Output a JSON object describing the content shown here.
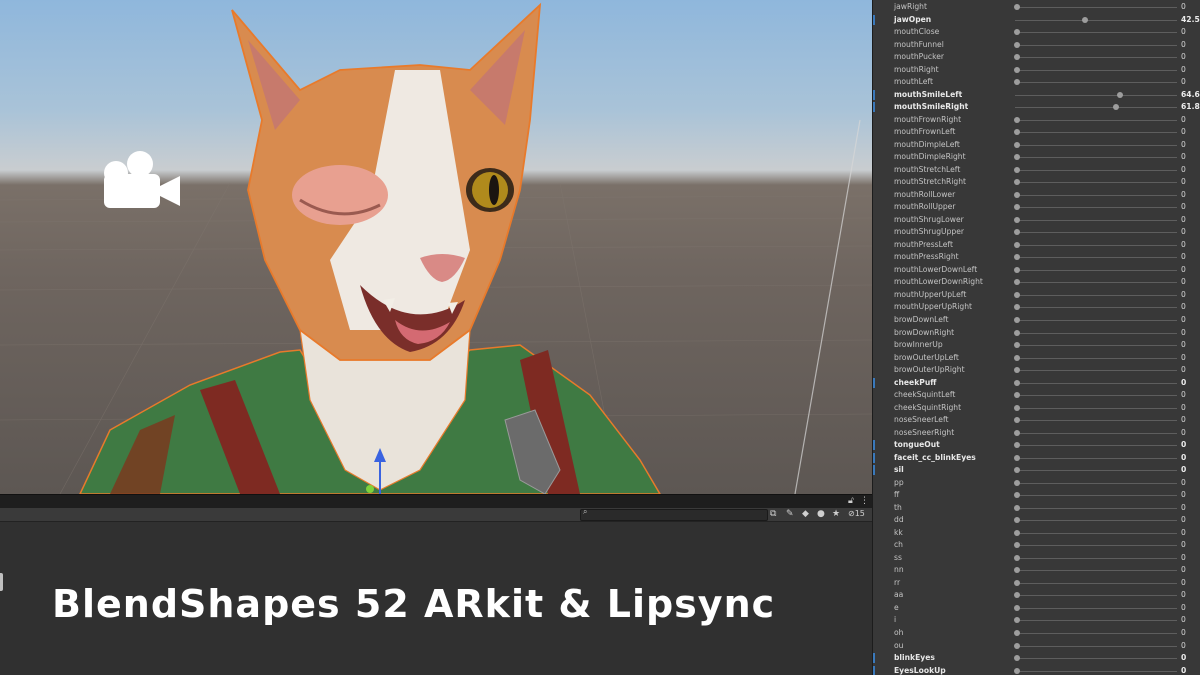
{
  "title": "BlendShapes 52 ARkit & Lipsync",
  "console": {
    "badge_count": "15"
  },
  "colors": {
    "accent": "#3a79bb",
    "selection_outline": "#e87a2b",
    "panel": "#383838"
  },
  "icons": [
    "camera-gizmo-icon",
    "search-icon",
    "lock-icon",
    "menu-icon",
    "filter-icon",
    "tag-icon",
    "error-icon",
    "star-icon",
    "visibility-icon"
  ],
  "blendshapes": [
    {
      "name": "jawRight",
      "value": "0",
      "fraction": 0,
      "bold": false
    },
    {
      "name": "jawOpen",
      "value": "42.5",
      "fraction": 0.425,
      "bold": true
    },
    {
      "name": "mouthClose",
      "value": "0",
      "fraction": 0,
      "bold": false
    },
    {
      "name": "mouthFunnel",
      "value": "0",
      "fraction": 0,
      "bold": false
    },
    {
      "name": "mouthPucker",
      "value": "0",
      "fraction": 0,
      "bold": false
    },
    {
      "name": "mouthRight",
      "value": "0",
      "fraction": 0,
      "bold": false
    },
    {
      "name": "mouthLeft",
      "value": "0",
      "fraction": 0,
      "bold": false
    },
    {
      "name": "mouthSmileLeft",
      "value": "64.6",
      "fraction": 0.646,
      "bold": true
    },
    {
      "name": "mouthSmileRight",
      "value": "61.8",
      "fraction": 0.618,
      "bold": true
    },
    {
      "name": "mouthFrownRight",
      "value": "0",
      "fraction": 0,
      "bold": false
    },
    {
      "name": "mouthFrownLeft",
      "value": "0",
      "fraction": 0,
      "bold": false
    },
    {
      "name": "mouthDimpleLeft",
      "value": "0",
      "fraction": 0,
      "bold": false
    },
    {
      "name": "mouthDimpleRight",
      "value": "0",
      "fraction": 0,
      "bold": false
    },
    {
      "name": "mouthStretchLeft",
      "value": "0",
      "fraction": 0,
      "bold": false
    },
    {
      "name": "mouthStretchRight",
      "value": "0",
      "fraction": 0,
      "bold": false
    },
    {
      "name": "mouthRollLower",
      "value": "0",
      "fraction": 0,
      "bold": false
    },
    {
      "name": "mouthRollUpper",
      "value": "0",
      "fraction": 0,
      "bold": false
    },
    {
      "name": "mouthShrugLower",
      "value": "0",
      "fraction": 0,
      "bold": false
    },
    {
      "name": "mouthShrugUpper",
      "value": "0",
      "fraction": 0,
      "bold": false
    },
    {
      "name": "mouthPressLeft",
      "value": "0",
      "fraction": 0,
      "bold": false
    },
    {
      "name": "mouthPressRight",
      "value": "0",
      "fraction": 0,
      "bold": false
    },
    {
      "name": "mouthLowerDownLeft",
      "value": "0",
      "fraction": 0,
      "bold": false
    },
    {
      "name": "mouthLowerDownRight",
      "value": "0",
      "fraction": 0,
      "bold": false
    },
    {
      "name": "mouthUpperUpLeft",
      "value": "0",
      "fraction": 0,
      "bold": false
    },
    {
      "name": "mouthUpperUpRight",
      "value": "0",
      "fraction": 0,
      "bold": false
    },
    {
      "name": "browDownLeft",
      "value": "0",
      "fraction": 0,
      "bold": false
    },
    {
      "name": "browDownRight",
      "value": "0",
      "fraction": 0,
      "bold": false
    },
    {
      "name": "browInnerUp",
      "value": "0",
      "fraction": 0,
      "bold": false
    },
    {
      "name": "browOuterUpLeft",
      "value": "0",
      "fraction": 0,
      "bold": false
    },
    {
      "name": "browOuterUpRight",
      "value": "0",
      "fraction": 0,
      "bold": false
    },
    {
      "name": "cheekPuff",
      "value": "0",
      "fraction": 0,
      "bold": true
    },
    {
      "name": "cheekSquintLeft",
      "value": "0",
      "fraction": 0,
      "bold": false
    },
    {
      "name": "cheekSquintRight",
      "value": "0",
      "fraction": 0,
      "bold": false
    },
    {
      "name": "noseSneerLeft",
      "value": "0",
      "fraction": 0,
      "bold": false
    },
    {
      "name": "noseSneerRight",
      "value": "0",
      "fraction": 0,
      "bold": false
    },
    {
      "name": "tongueOut",
      "value": "0",
      "fraction": 0,
      "bold": true
    },
    {
      "name": "faceit_cc_blinkEyes",
      "value": "0",
      "fraction": 0,
      "bold": true
    },
    {
      "name": "sil",
      "value": "0",
      "fraction": 0,
      "bold": true
    },
    {
      "name": "pp",
      "value": "0",
      "fraction": 0,
      "bold": false
    },
    {
      "name": "ff",
      "value": "0",
      "fraction": 0,
      "bold": false
    },
    {
      "name": "th",
      "value": "0",
      "fraction": 0,
      "bold": false
    },
    {
      "name": "dd",
      "value": "0",
      "fraction": 0,
      "bold": false
    },
    {
      "name": "kk",
      "value": "0",
      "fraction": 0,
      "bold": false
    },
    {
      "name": "ch",
      "value": "0",
      "fraction": 0,
      "bold": false
    },
    {
      "name": "ss",
      "value": "0",
      "fraction": 0,
      "bold": false
    },
    {
      "name": "nn",
      "value": "0",
      "fraction": 0,
      "bold": false
    },
    {
      "name": "rr",
      "value": "0",
      "fraction": 0,
      "bold": false
    },
    {
      "name": "aa",
      "value": "0",
      "fraction": 0,
      "bold": false
    },
    {
      "name": "e",
      "value": "0",
      "fraction": 0,
      "bold": false
    },
    {
      "name": "i",
      "value": "0",
      "fraction": 0,
      "bold": false
    },
    {
      "name": "oh",
      "value": "0",
      "fraction": 0,
      "bold": false
    },
    {
      "name": "ou",
      "value": "0",
      "fraction": 0,
      "bold": false
    },
    {
      "name": "blinkEyes",
      "value": "0",
      "fraction": 0,
      "bold": true
    },
    {
      "name": "EyesLookUp",
      "value": "0",
      "fraction": 0,
      "bold": true
    }
  ]
}
